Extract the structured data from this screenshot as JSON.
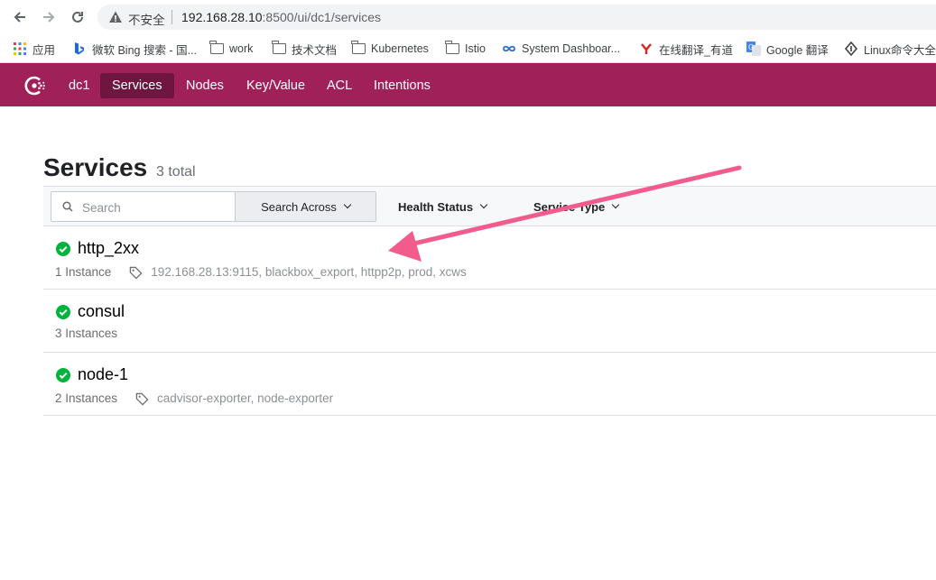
{
  "browser": {
    "back_icon": "arrow-left-icon",
    "forward_icon": "arrow-right-icon",
    "reload_icon": "reload-icon",
    "security_label": "不安全",
    "url_host": "192.168.28.10",
    "url_rest": ":8500/ui/dc1/services"
  },
  "bookmarks": [
    {
      "label": "应用",
      "icon": "apps-grid-icon"
    },
    {
      "label": "微软 Bing 搜索 - 国...",
      "icon": "bing-icon"
    },
    {
      "label": "work",
      "icon": "folder-icon"
    },
    {
      "label": "技术文档",
      "icon": "folder-icon"
    },
    {
      "label": "Kubernetes",
      "icon": "folder-icon"
    },
    {
      "label": "Istio",
      "icon": "folder-icon"
    },
    {
      "label": "System Dashboar...",
      "icon": "infinity-icon"
    },
    {
      "label": "在线翻译_有道",
      "icon": "youdao-icon"
    },
    {
      "label": "Google 翻译",
      "icon": "google-translate-icon"
    },
    {
      "label": "Linux命令大全",
      "icon": "linux-icon"
    }
  ],
  "topnav": {
    "brand_color": "#a0215a",
    "datacenter": "dc1",
    "items": [
      "Services",
      "Nodes",
      "Key/Value",
      "ACL",
      "Intentions"
    ],
    "active": "Services"
  },
  "page": {
    "title": "Services",
    "count": "3 total"
  },
  "filters": {
    "search_placeholder": "Search",
    "search_across": "Search Across",
    "health_status": "Health Status",
    "service_type": "Service Type"
  },
  "services": [
    {
      "name": "http_2xx",
      "instances": "1 Instance",
      "tags": "192.168.28.13:9115, blackbox_export, httpp2p, prod, xcws",
      "status": "passing"
    },
    {
      "name": "consul",
      "instances": "3 Instances",
      "tags": "",
      "status": "passing"
    },
    {
      "name": "node-1",
      "instances": "2 Instances",
      "tags": "cadvisor-exporter, node-exporter",
      "status": "passing"
    }
  ],
  "colors": {
    "passing": "#00b33c",
    "annotation_arrow": "#f25c8c"
  }
}
